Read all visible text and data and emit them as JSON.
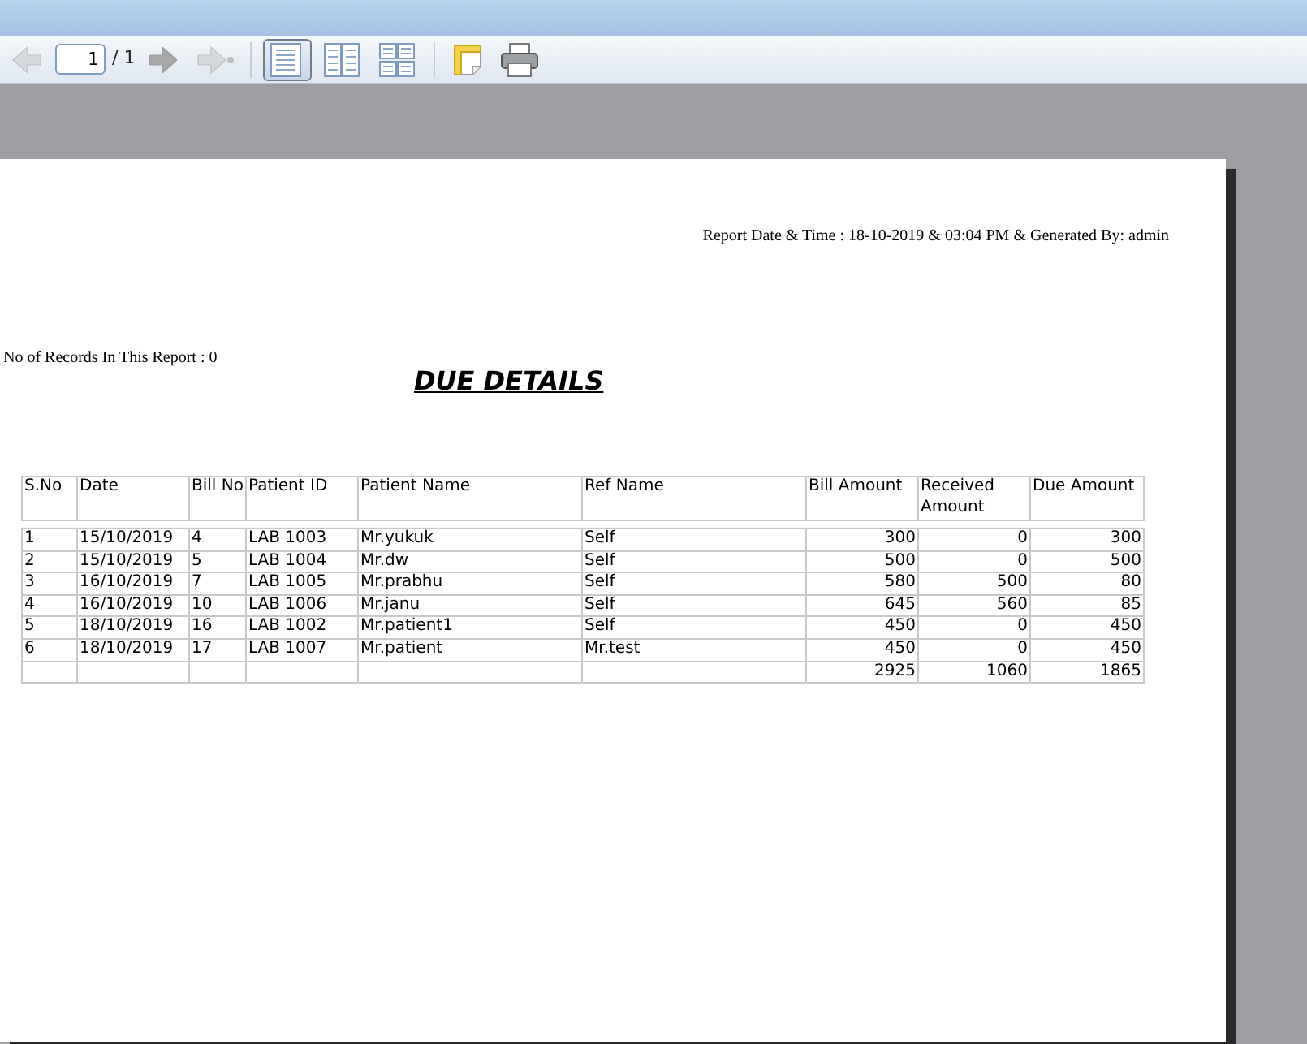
{
  "toolbar": {
    "page_input": "1",
    "page_total": "/ 1",
    "nav": [
      {
        "kind": "prev",
        "disabled": true
      },
      {
        "kind": "next",
        "disabled": false
      },
      {
        "kind": "last",
        "disabled": true
      }
    ],
    "views": [
      {
        "kind": "single",
        "selected": true
      },
      {
        "kind": "double",
        "selected": false
      },
      {
        "kind": "quad",
        "selected": false
      }
    ]
  },
  "report": {
    "generated": "Report Date & Time : 18-10-2019 & 03:04 PM & Generated By: admin",
    "records": "No of Records In This Report : 0",
    "title": "DUE DETAILS",
    "columns": [
      "S.No",
      "Date",
      "Bill No",
      "Patient ID",
      "Patient Name",
      "Ref Name",
      "Bill Amount",
      "Received Amount",
      "Due Amount"
    ],
    "rows": [
      [
        "1",
        "15/10/2019",
        "4",
        "LAB 1003",
        "Mr.yukuk",
        "Self",
        "300",
        "0",
        "300"
      ],
      [
        "2",
        "15/10/2019",
        "5",
        "LAB 1004",
        "Mr.dw",
        "Self",
        "500",
        "0",
        "500"
      ],
      [
        "3",
        "16/10/2019",
        "7",
        "LAB 1005",
        "Mr.prabhu",
        "Self",
        "580",
        "500",
        "80"
      ],
      [
        "4",
        "16/10/2019",
        "10",
        "LAB 1006",
        "Mr.janu",
        "Self",
        "645",
        "560",
        "85"
      ],
      [
        "5",
        "18/10/2019",
        "16",
        "LAB 1002",
        "Mr.patient1",
        "Self",
        "450",
        "0",
        "450"
      ],
      [
        "6",
        "18/10/2019",
        "17",
        "LAB 1007",
        "Mr.patient",
        "Mr.test",
        "450",
        "0",
        "450"
      ]
    ],
    "totals": {
      "bill_amount": "2925",
      "received_amount": "1060",
      "due_amount": "1865"
    }
  }
}
